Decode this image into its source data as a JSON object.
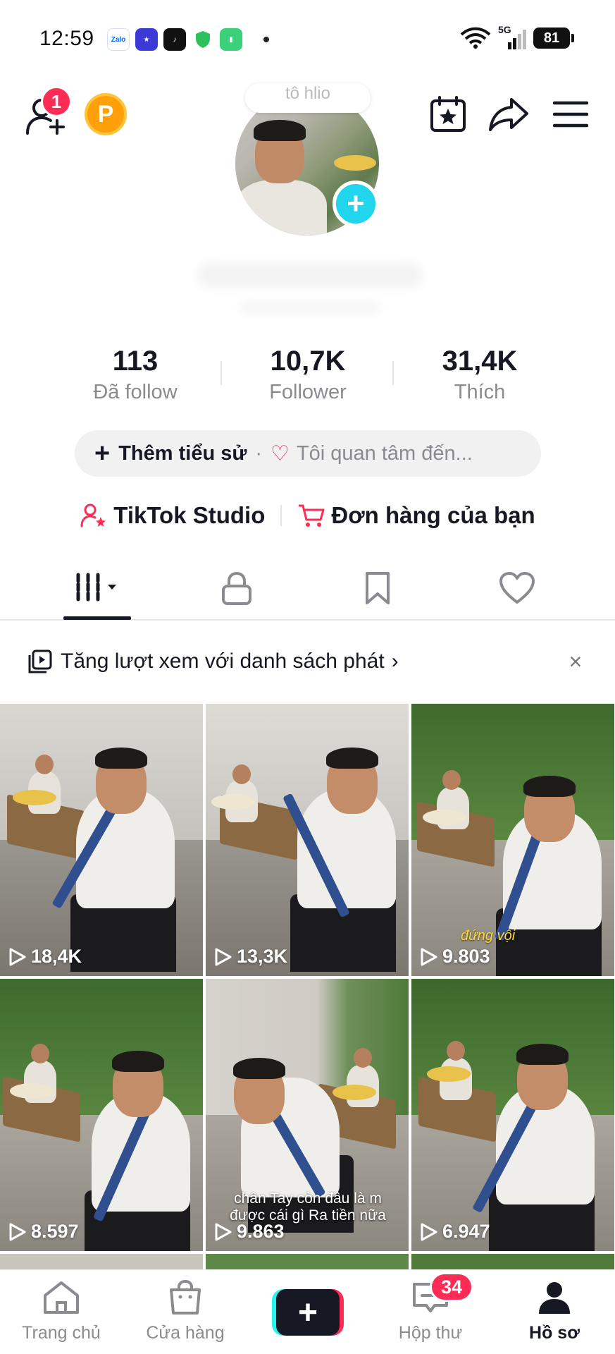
{
  "status_bar": {
    "time": "12:59",
    "network": "5G",
    "battery": "81",
    "apps": [
      "Zalo",
      "star-app",
      "tiktok",
      "shield-app",
      "battery-app"
    ]
  },
  "header": {
    "friend_badge": "1",
    "coin_label": "P",
    "note_text": "tô hlio"
  },
  "stats": {
    "following": {
      "value": "113",
      "label": "Đã follow"
    },
    "followers": {
      "value": "10,7K",
      "label": "Follower"
    },
    "likes": {
      "value": "31,4K",
      "label": "Thích"
    }
  },
  "bio": {
    "add_label": "Thêm tiểu sử",
    "separator": "·",
    "interest_label": "Tôi quan tâm đến..."
  },
  "tools": {
    "studio_label": "TikTok Studio",
    "orders_label": "Đơn hàng của bạn"
  },
  "tabs": [
    "videos-grid",
    "private",
    "saved",
    "liked"
  ],
  "banner": {
    "text": "Tăng lượt xem với danh sách phát",
    "chevron": "›",
    "close": "×"
  },
  "videos": [
    {
      "views": "18,4K",
      "caption": ""
    },
    {
      "views": "13,3K",
      "caption": ""
    },
    {
      "views": "9.803",
      "caption": "đứng vội"
    },
    {
      "views": "8.597",
      "caption": ""
    },
    {
      "views": "9.863",
      "caption": "chân Tay còn đâu là m được cái gì Ra tiền nữa"
    },
    {
      "views": "6.947",
      "caption": ""
    }
  ],
  "bottom_nav": {
    "home": "Trang chủ",
    "shop": "Cửa hàng",
    "create": "+",
    "inbox": "Hộp thư",
    "inbox_badge": "34",
    "profile": "Hồ sơ"
  },
  "colors": {
    "accent_red": "#fe2c55",
    "accent_cyan": "#20d5ec",
    "coin_orange": "#ff9f0a",
    "text_primary": "#161823",
    "text_secondary": "#8a8b91"
  }
}
